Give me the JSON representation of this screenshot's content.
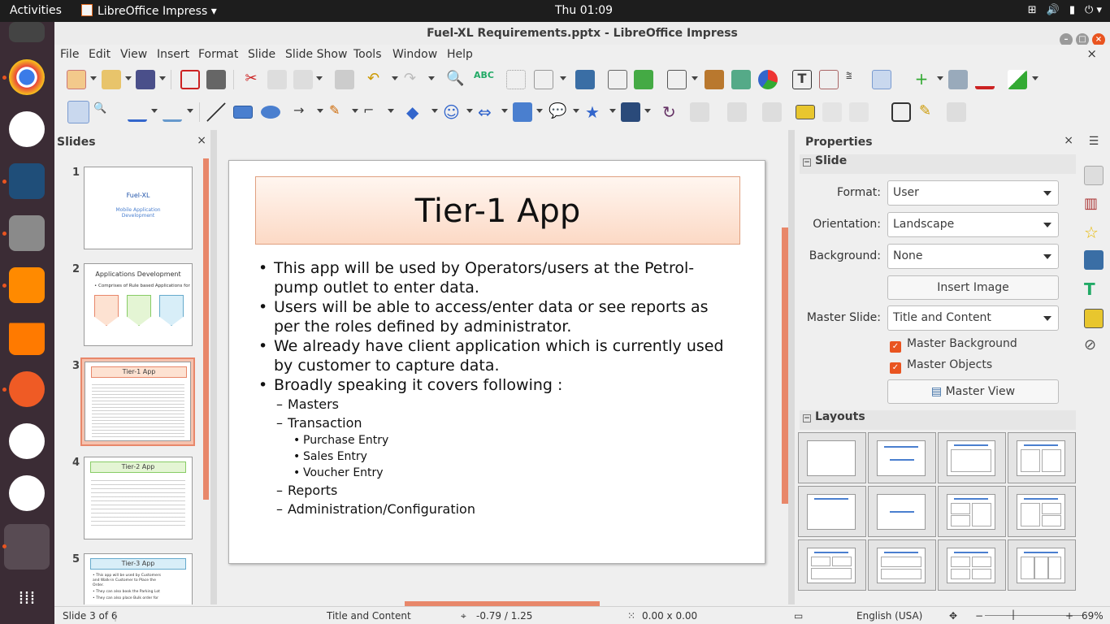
{
  "topbar": {
    "activities": "Activities",
    "app": "LibreOffice Impress",
    "clock": "Thu 01:09"
  },
  "window": {
    "title": "Fuel-XL Requirements.pptx - LibreOffice Impress"
  },
  "menu": [
    "File",
    "Edit",
    "View",
    "Insert",
    "Format",
    "Slide",
    "Slide Show",
    "Tools",
    "Window",
    "Help"
  ],
  "slides_panel": {
    "title": "Slides",
    "close": "×"
  },
  "thumbs": {
    "t1": {
      "num": "1",
      "title": "Fuel-XL",
      "sub1": "Mobile Application",
      "sub2": "Development"
    },
    "t2": {
      "num": "2",
      "title": "Applications Development",
      "line": "• Comprises of Rule based Applications for"
    },
    "t3": {
      "num": "3",
      "title": "Tier-1 App"
    },
    "t4": {
      "num": "4",
      "title": "Tier-2 App"
    },
    "t5": {
      "num": "5",
      "title": "Tier-3 App",
      "l1": "• This app will be used by Customers",
      "l2": "and Walk-in Customer to Place the",
      "l3": "Order.",
      "l4": "• They can also book the Parking Lot",
      "l5": "• They can also place Bulk order for"
    }
  },
  "slide": {
    "title": "Tier-1 App",
    "b1": "This app will be used by Operators/users at the Petrol-pump outlet to enter data.",
    "b2": "Users will be able to access/enter data or see reports as per the roles defined by administrator.",
    "b3": "We already have client application which is currently used by customer to capture data.",
    "b4": "Broadly speaking it covers following :",
    "s1": "Masters",
    "s2": "Transaction",
    "ss1": "Purchase Entry",
    "ss2": "Sales Entry",
    "ss3": "Voucher Entry",
    "s3": "Reports",
    "s4": "Administration/Configuration"
  },
  "properties": {
    "title": "Properties",
    "close": "×",
    "slide_section": "Slide",
    "format_label": "Format:",
    "format_value": "User",
    "orientation_label": "Orientation:",
    "orientation_value": "Landscape",
    "background_label": "Background:",
    "background_value": "None",
    "insert_image": "Insert Image",
    "master_label": "Master Slide:",
    "master_value": "Title and Content",
    "master_background": "Master Background",
    "master_objects": "Master Objects",
    "master_view": "Master View",
    "layouts_section": "Layouts"
  },
  "status": {
    "slide": "Slide 3 of 6",
    "layout": "Title and Content",
    "pos": "-0.79 / 1.25",
    "size": "0.00 x 0.00",
    "lang": "English (USA)",
    "zoom": "69%"
  }
}
